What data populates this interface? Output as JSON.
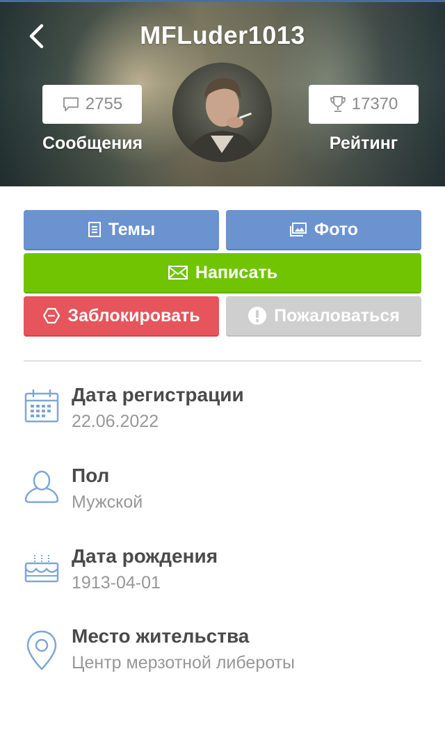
{
  "header": {
    "username": "MFLuder1013",
    "messages": {
      "count": "2755",
      "label": "Сообщения",
      "icon": "speech-bubble-icon"
    },
    "rating": {
      "count": "17370",
      "label": "Рейтинг",
      "icon": "trophy-icon"
    }
  },
  "actions": {
    "topics": "Темы",
    "photo": "Фото",
    "write": "Написать",
    "block": "Заблокировать",
    "report": "Пожаловаться"
  },
  "colors": {
    "blue": "#6b93cf",
    "green": "#71c402",
    "red": "#e5555b",
    "grey": "#cfcfcf",
    "icon_blue": "#7ea6d6"
  },
  "info": [
    {
      "title": "Дата регистрации",
      "value": "22.06.2022",
      "icon": "calendar-icon"
    },
    {
      "title": "Пол",
      "value": "Мужской",
      "icon": "user-icon"
    },
    {
      "title": "Дата рождения",
      "value": "1913-04-01",
      "icon": "birthday-cake-icon"
    },
    {
      "title": "Место жительства",
      "value": "Центр мерзотной либероты",
      "icon": "location-pin-icon"
    }
  ]
}
